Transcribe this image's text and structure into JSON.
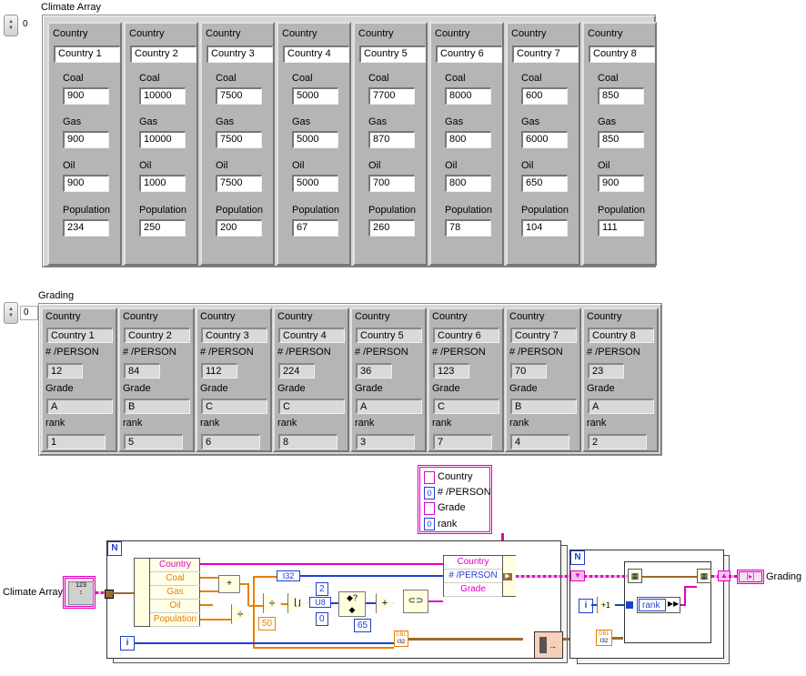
{
  "climate_array": {
    "label": "Climate Array",
    "index_value": "0",
    "field_labels": {
      "country": "Country",
      "coal": "Coal",
      "gas": "Gas",
      "oil": "Oil",
      "population": "Population"
    },
    "rows": [
      {
        "country": "Country 1",
        "coal": "900",
        "gas": "900",
        "third_label": "Oil",
        "oil": "900",
        "population": "234"
      },
      {
        "country": "Country 2",
        "coal": "10000",
        "gas": "10000",
        "third_label": "Oil",
        "oil": "1000",
        "population": "250"
      },
      {
        "country": "Country 3",
        "coal": "7500",
        "gas": "7500",
        "third_label": "Oil",
        "oil": "7500",
        "population": "200"
      },
      {
        "country": "Country 4",
        "coal": "5000",
        "gas": "5000",
        "third_label": "Oil",
        "oil": "5000",
        "population": "67"
      },
      {
        "country": "Country 5",
        "coal": "7700",
        "gas": "870",
        "third_label": "Oil",
        "oil": "700",
        "population": "260"
      },
      {
        "country": "Country 6",
        "coal": "8000",
        "gas": "800",
        "third_label": "Oil",
        "oil": "800",
        "population": "78"
      },
      {
        "country": "Country 7",
        "coal": "600",
        "gas": "6000",
        "third_label": "Oil",
        "oil": "650",
        "population": "104"
      },
      {
        "country": "Country 8",
        "coal": "850",
        "gas": "850",
        "third_label": "Oil",
        "oil": "900",
        "population": "111"
      }
    ]
  },
  "grading": {
    "label": "Grading",
    "index_value": "0",
    "field_labels": {
      "country": "Country",
      "per_person": "# /PERSON",
      "grade": "Grade",
      "rank": "rank"
    },
    "rows": [
      {
        "country": "Country 1",
        "per_person": "12",
        "grade": "A",
        "rank": "1"
      },
      {
        "country": "Country 2",
        "per_person": "84",
        "grade": "B",
        "rank": "5"
      },
      {
        "country": "Country 3",
        "per_person": "112",
        "grade": "C",
        "rank": "6"
      },
      {
        "country": "Country 4",
        "per_person": "224",
        "grade": "C",
        "rank": "8"
      },
      {
        "country": "Country 5",
        "per_person": "36",
        "grade": "A",
        "rank": "3"
      },
      {
        "country": "Country 6",
        "per_person": "123",
        "grade": "C",
        "rank": "7"
      },
      {
        "country": "Country 7",
        "per_person": "70",
        "grade": "B",
        "rank": "4"
      },
      {
        "country": "Country 8",
        "per_person": "23",
        "grade": "A",
        "rank": "2"
      }
    ]
  },
  "diagram": {
    "cluster_constant": {
      "country": "Country",
      "per_person": "# /PERSON",
      "grade": "Grade",
      "rank": "rank",
      "num0": "0",
      "num1": "0"
    },
    "climate_terminal_label": "Climate Array",
    "grading_terminal_label": "Grading",
    "unbundle_fields": [
      "Country",
      "Coal",
      "Gas",
      "Oil",
      "Population"
    ],
    "bundle_fields": [
      "Country",
      "# /PERSON",
      "Grade"
    ],
    "loop1_count": "N",
    "loop2_count": "N",
    "iter": "i",
    "const_50": "50",
    "const_2": "2",
    "const_0": "0",
    "const_65": "65",
    "i32_label": "I32",
    "u8_label": "U8",
    "dbl_label": "DBL",
    "plus_one": "+1",
    "rank_field": "rank",
    "colors": {
      "string": "#e000c0",
      "numeric_int": "#2040d0",
      "numeric_dbl": "#e87f00",
      "cluster": "#9a6a30"
    }
  }
}
